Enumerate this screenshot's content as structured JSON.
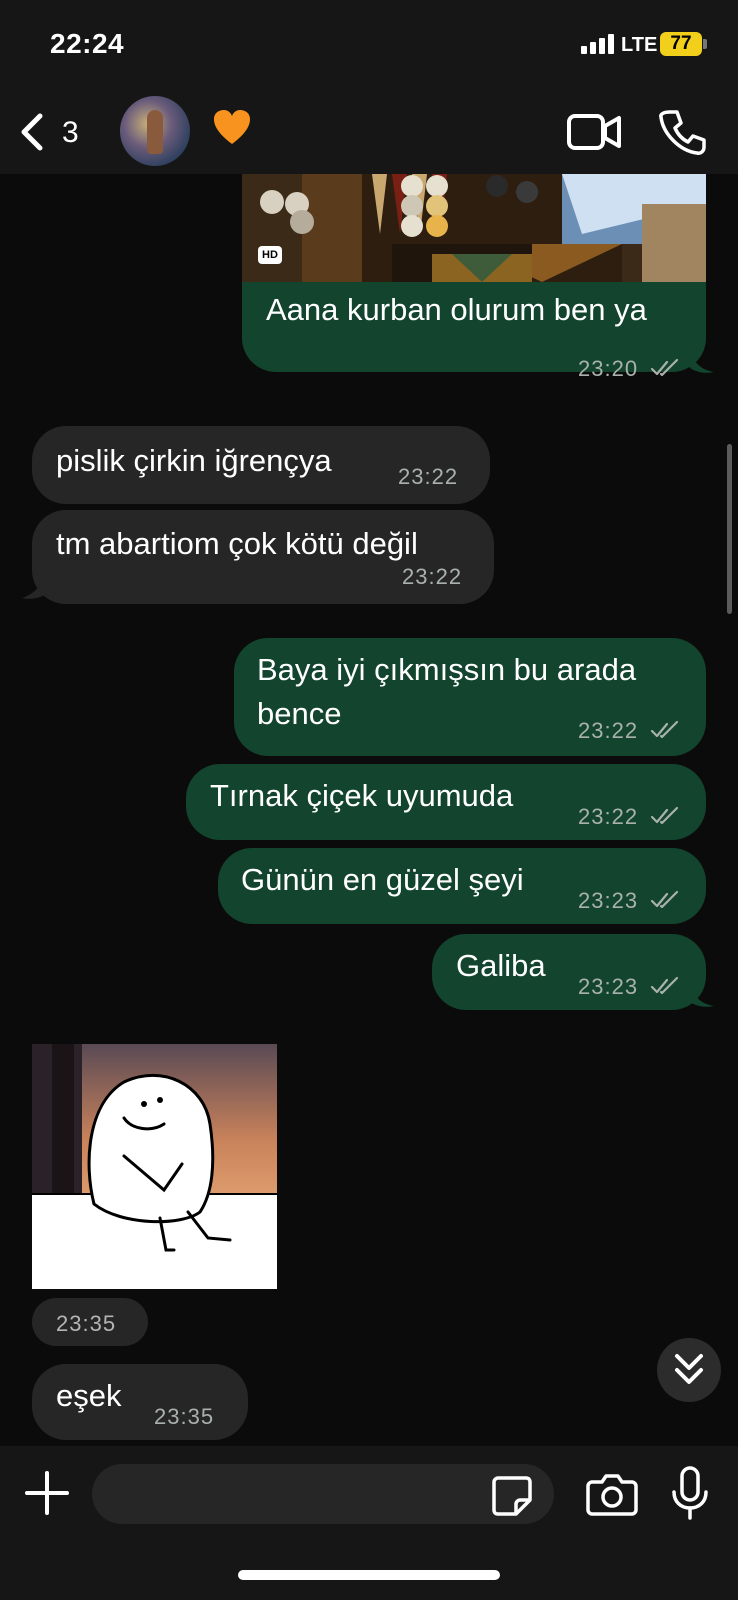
{
  "status_bar": {
    "time": "22:24",
    "network": "LTE",
    "battery": "77"
  },
  "header": {
    "back_count": "3",
    "contact_emoji": "🧡",
    "icons": {
      "back": "chevron-left-icon",
      "video": "video-camera-icon",
      "call": "phone-icon"
    }
  },
  "messages": [
    {
      "direction": "out",
      "text": "Aana kurban olurum ben ya",
      "time": "23:20",
      "read": true,
      "has_image": true,
      "image_badge": "HD"
    },
    {
      "direction": "in",
      "text": "pislik çirkin iğrençya",
      "time": "23:22"
    },
    {
      "direction": "in",
      "text": "tm abartiom çok kötü değil",
      "time": "23:22"
    },
    {
      "direction": "out",
      "text": "Baya iyi çıkmışsın bu arada bence",
      "time": "23:22",
      "read": true
    },
    {
      "direction": "out",
      "text": "Tırnak çiçek uyumuda",
      "time": "23:22",
      "read": true
    },
    {
      "direction": "out",
      "text": "Günün en güzel şeyi",
      "time": "23:23",
      "read": true
    },
    {
      "direction": "out",
      "text": "Galiba",
      "time": "23:23",
      "read": true
    },
    {
      "direction": "in",
      "type": "sticker",
      "time": "23:35"
    },
    {
      "direction": "in",
      "text": "eşek",
      "time": "23:35"
    }
  ],
  "input": {
    "placeholder": ""
  },
  "colors": {
    "outgoing_bubble": "#12442e",
    "incoming_bubble": "#262626",
    "background": "#0b0b0b",
    "battery": "#f2cf1a"
  }
}
